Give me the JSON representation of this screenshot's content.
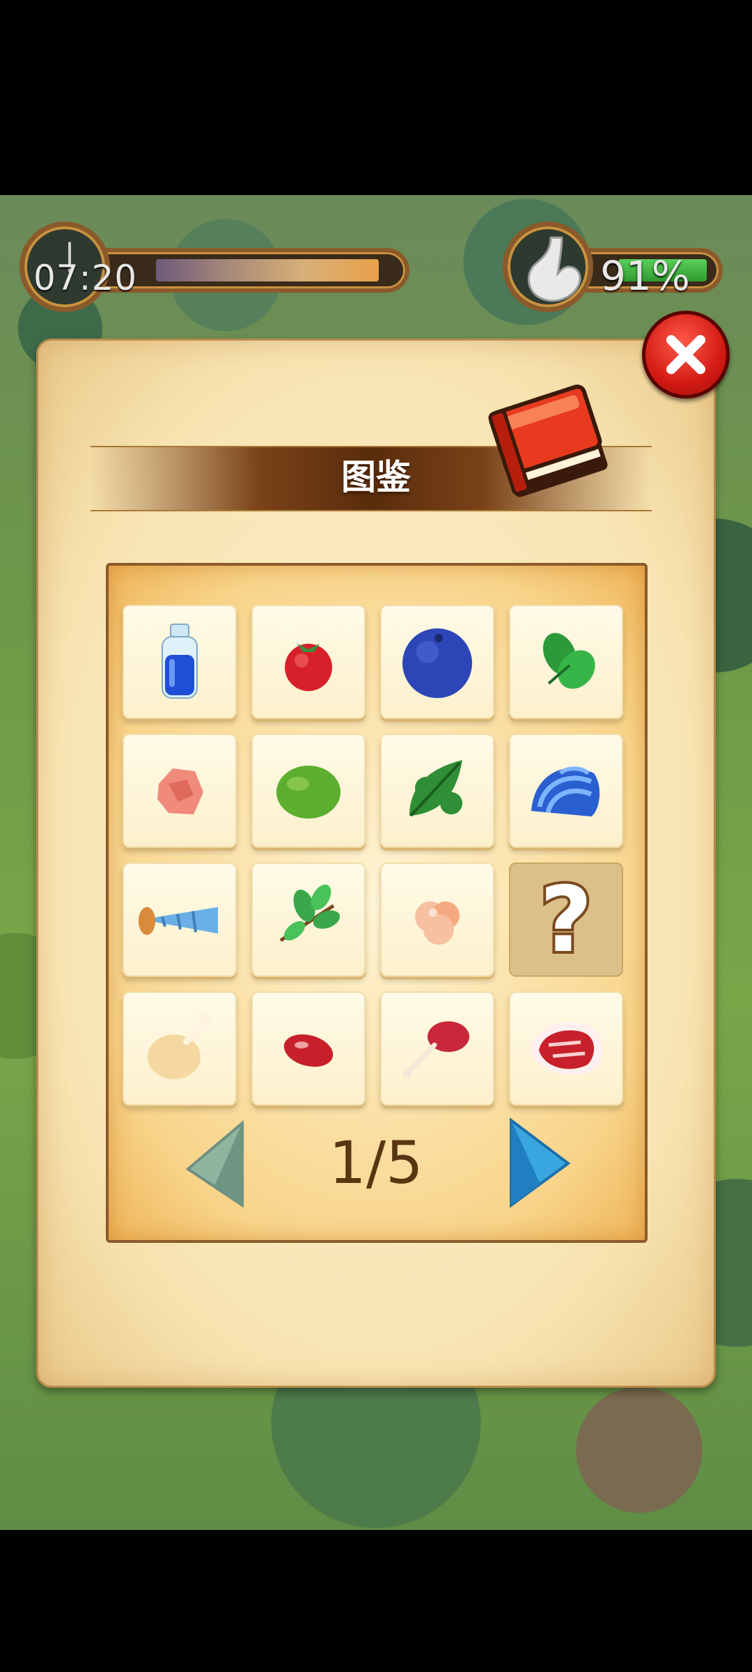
{
  "hud": {
    "time": "07:20",
    "time_progress": 0.85,
    "stomach_percent": "91%",
    "stomach_fill": 0.91
  },
  "panel": {
    "title": "图鉴",
    "page_indicator": "1/5"
  },
  "items": [
    {
      "name": "blue-potion-bottle-icon",
      "locked": false
    },
    {
      "name": "red-berry-icon",
      "locked": false
    },
    {
      "name": "blueberry-icon",
      "locked": false
    },
    {
      "name": "spinach-leaves-icon",
      "locked": false
    },
    {
      "name": "raw-meat-chunk-icon",
      "locked": false
    },
    {
      "name": "green-fruit-icon",
      "locked": false
    },
    {
      "name": "green-leaf-icon",
      "locked": false
    },
    {
      "name": "blue-shell-icon",
      "locked": false
    },
    {
      "name": "cone-shell-icon",
      "locked": false
    },
    {
      "name": "herb-sprig-icon",
      "locked": false
    },
    {
      "name": "pink-fruit-icon",
      "locked": false
    },
    {
      "name": "unknown-item-icon",
      "locked": true,
      "label": "?"
    },
    {
      "name": "chicken-drumstick-icon",
      "locked": false
    },
    {
      "name": "small-meat-icon",
      "locked": false
    },
    {
      "name": "lamb-chop-icon",
      "locked": false
    },
    {
      "name": "steak-icon",
      "locked": false
    }
  ]
}
